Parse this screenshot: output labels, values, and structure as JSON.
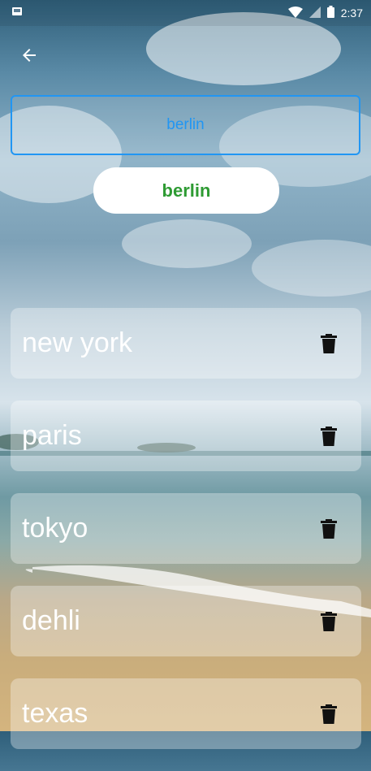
{
  "status_bar": {
    "time": "2:37"
  },
  "search": {
    "value": "berlin",
    "placeholder": "berlin"
  },
  "submit_button": {
    "label": "berlin"
  },
  "cities": [
    {
      "name": "new york",
      "icon": "trash-icon"
    },
    {
      "name": "paris",
      "icon": "trash-icon"
    },
    {
      "name": "tokyo",
      "icon": "trash-icon"
    },
    {
      "name": "dehli",
      "icon": "trash-icon"
    },
    {
      "name": "texas",
      "icon": "trash-icon"
    }
  ],
  "colors": {
    "accent": "#2196f3",
    "button_text": "#2e9b33",
    "card_bg": "rgba(255,255,255,0.33)"
  }
}
